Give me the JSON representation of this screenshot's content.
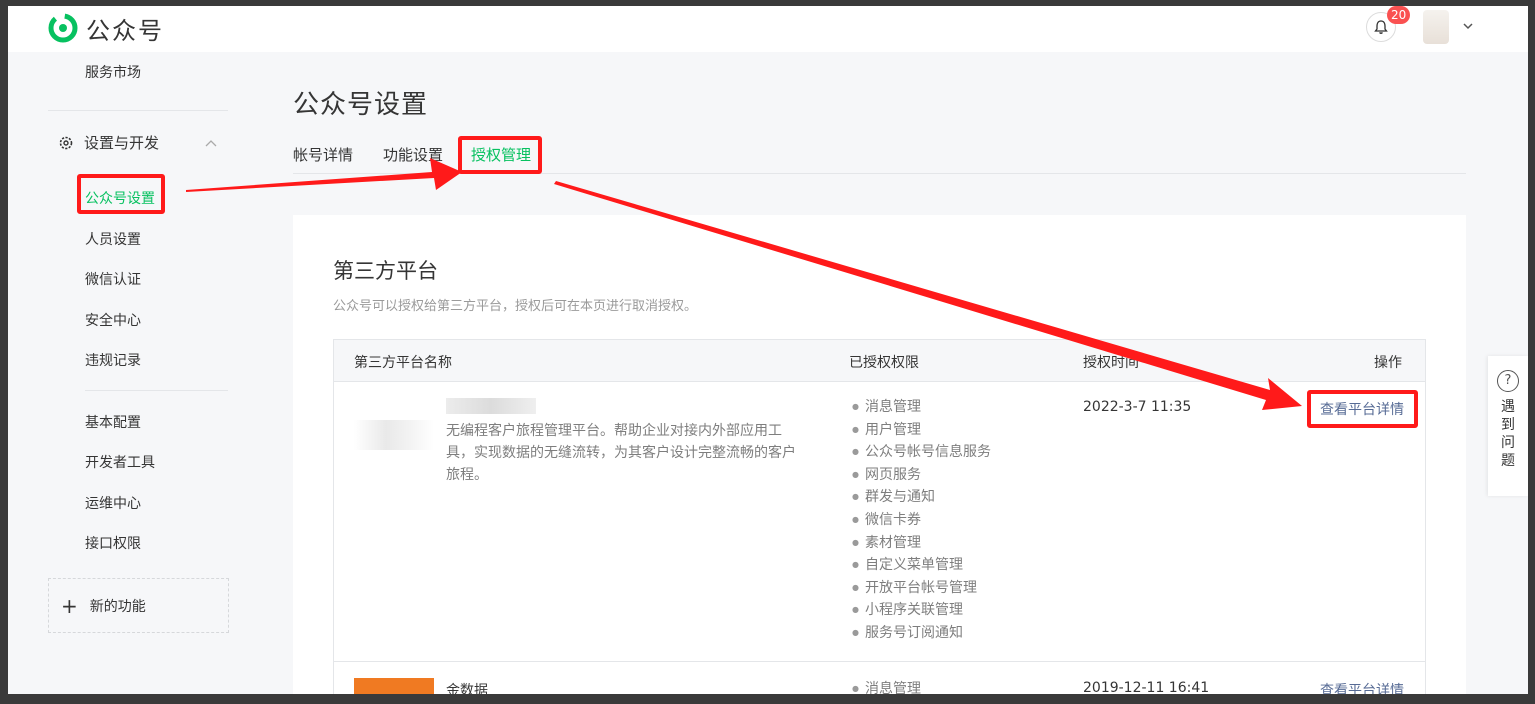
{
  "app": {
    "brand_name": "公众号",
    "notification_count": "20",
    "brand_color": "#07c160",
    "link_color": "#576b95",
    "highlight_color": "#ff1a1a"
  },
  "sidebar": {
    "top_item": "服务市场",
    "group_label": "设置与开发",
    "group_icon": "gear-icon",
    "items": [
      "公众号设置",
      "人员设置",
      "微信认证",
      "安全中心",
      "违规记录"
    ],
    "items2": [
      "基本配置",
      "开发者工具",
      "运维中心",
      "接口权限"
    ],
    "new_feature": "新的功能"
  },
  "page": {
    "title": "公众号设置",
    "tabs": [
      "帐号详情",
      "功能设置",
      "授权管理"
    ],
    "active_tab": "授权管理"
  },
  "section": {
    "title": "第三方平台",
    "desc": "公众号可以授权给第三方平台，授权后可在本页进行取消授权。"
  },
  "table": {
    "headers": [
      "第三方平台名称",
      "已授权权限",
      "授权时间",
      "操作"
    ],
    "rows": [
      {
        "desc": "无编程客户旅程管理平台。帮助企业对接内外部应用工具，实现数据的无缝流转，为其客户设计完整流畅的客户旅程。",
        "permissions": [
          "消息管理",
          "用户管理",
          "公众号帐号信息服务",
          "网页服务",
          "群发与通知",
          "微信卡券",
          "素材管理",
          "自定义菜单管理",
          "开放平台帐号管理",
          "小程序关联管理",
          "服务号订阅通知"
        ],
        "time": "2022-3-7 11:35",
        "action": "查看平台详情"
      },
      {
        "name": "金数据",
        "permissions": [
          "消息管理"
        ],
        "time": "2019-12-11 16:41",
        "action": "查看平台详情"
      }
    ]
  },
  "help": {
    "label": "遇到问题",
    "icon": "question-circle-icon"
  }
}
